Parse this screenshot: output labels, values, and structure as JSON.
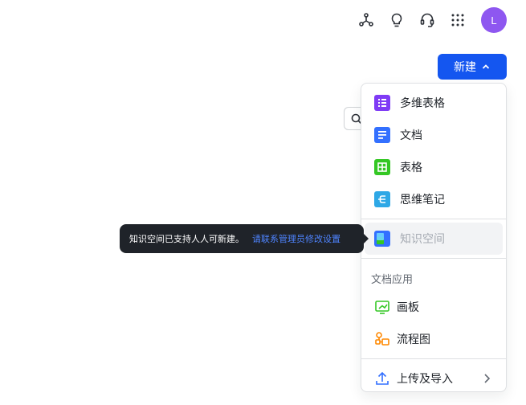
{
  "topbar": {
    "icons": [
      "network-icon",
      "lightbulb-icon",
      "headset-icon",
      "grid-apps-icon"
    ],
    "avatar_letter": "L",
    "avatar_color": "#8e57f0"
  },
  "new_button": {
    "label": "新建",
    "color": "#1456f0"
  },
  "menu": {
    "items": [
      {
        "label": "多维表格",
        "icon": "bitable-icon",
        "color": "#7f3bf5"
      },
      {
        "label": "文档",
        "icon": "doc-icon",
        "color": "#3370ff"
      },
      {
        "label": "表格",
        "icon": "sheet-icon",
        "color": "#34c724"
      },
      {
        "label": "思维笔记",
        "icon": "mindnote-icon",
        "color": "#2ea8e6"
      },
      {
        "label": "知识空间",
        "icon": "wiki-space-icon",
        "disabled": true
      }
    ],
    "section_label": "文档应用",
    "apps": [
      {
        "label": "画板",
        "icon": "whiteboard-icon",
        "color": "#34c724"
      },
      {
        "label": "流程图",
        "icon": "flowchart-icon",
        "color": "#ff8800"
      }
    ],
    "upload": {
      "label": "上传及导入",
      "icon": "upload-icon",
      "color": "#3370ff"
    }
  },
  "tooltip": {
    "text": "知识空间已支持人人可新建。",
    "link": "请联系管理员修改设置"
  }
}
